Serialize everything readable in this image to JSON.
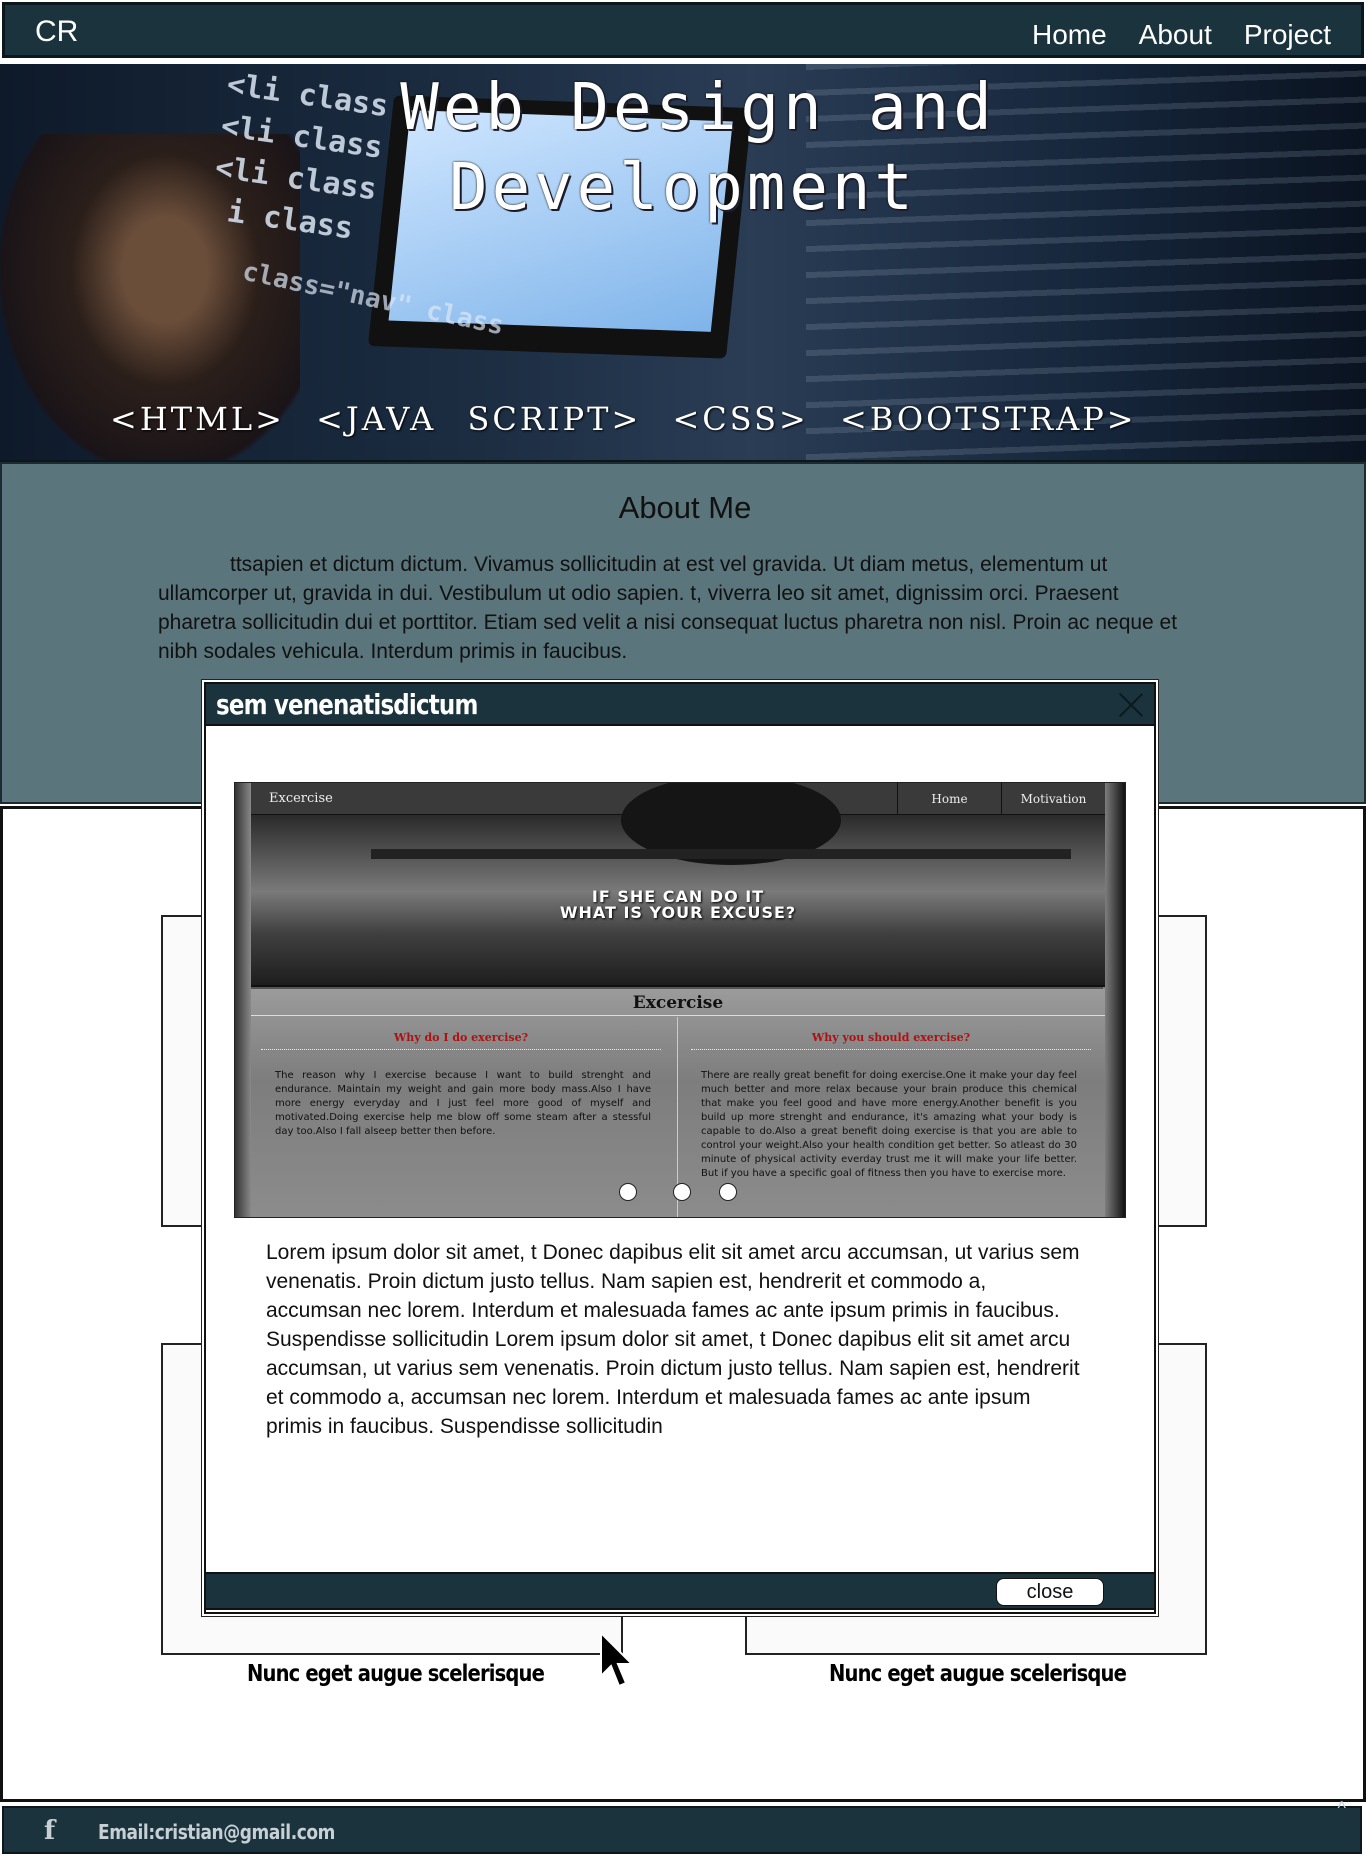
{
  "nav": {
    "brand": "CR",
    "links": [
      "Home",
      "About",
      "Project"
    ]
  },
  "hero": {
    "title_line1": "Web Design and",
    "title_line2": "Development",
    "tags": "<HTML> <JAVA SCRIPT> <CSS> <BOOTSTRAP>"
  },
  "about": {
    "title": "About Me",
    "text": "ttsapien et dictum dictum. Vivamus sollicitudin at est vel gravida. Ut diam metus, elementum ut ullamcorper ut, gravida in dui. Vestibulum ut odio sapien. t, viverra leo sit amet, dignissim orci. Praesent pharetra sollicitudin dui et porttitor. Etiam sed velit a nisi consequat luctus pharetra non nisl. Proin ac neque et nibh sodales vehicula. Interdum  primis in faucibus."
  },
  "projects": {
    "captions": [
      "Nunc eget augue scelerisque",
      "Nunc eget augue scelerisque"
    ]
  },
  "modal": {
    "title": "sem venenatisdictum",
    "body": "Lorem ipsum dolor sit amet, t Donec dapibus elit sit amet arcu accumsan, ut varius sem venenatis. Proin dictum justo tellus. Nam sapien est, hendrerit et commodo a, accumsan nec lorem. Interdum et malesuada fames ac ante ipsum primis in faucibus. Suspendisse sollicitudin Lorem ipsum dolor sit amet, t Donec dapibus elit sit amet arcu accumsan, ut varius sem venenatis. Proin dictum justo tellus. Nam sapien est, hendrerit et commodo a, accumsan nec lorem. Interdum et malesuada fames ac ante ipsum primis in faucibus. Suspendisse sollicitudin",
    "close_label": "close",
    "screenshot": {
      "brand": "Excercise",
      "nav": [
        "Home",
        "Motivation"
      ],
      "slogan_line1": "IF SHE CAN DO IT",
      "slogan_line2": "WHAT IS YOUR EXCUSE?",
      "heading": "Excercise",
      "left_title": "Why do I do exercise?",
      "left_text": "The reason why I exercise because I want to build strenght and endurance. Maintain my weight and gain more body mass.Also I have more energy everyday and I just feel more good of myself and motivated.Doing exercise help me blow off some steam after a stessful day too.Also I fall alseep better then before.",
      "right_title": "Why you should exercise?",
      "right_text": "There are really great benefit for doing exercise.One it make your day feel much better and more relax because your brain produce this chemical that make you feel good and have more energy.Another benefit is you build up more strenght and endurance, it's amazing what your body is capable to do.Also a great benefit doing exercise is that you are able to control your weight.Also your health condition get better. So atleast do 30 minute of physical activity everday trust me it will make your life better. But if you have a specific goal of fitness then you have to exercise more.",
      "carousel_dots": 3
    }
  },
  "footer": {
    "facebook_icon": "f",
    "email": "Email:cristian@gmail.com",
    "up_icon": "^"
  }
}
